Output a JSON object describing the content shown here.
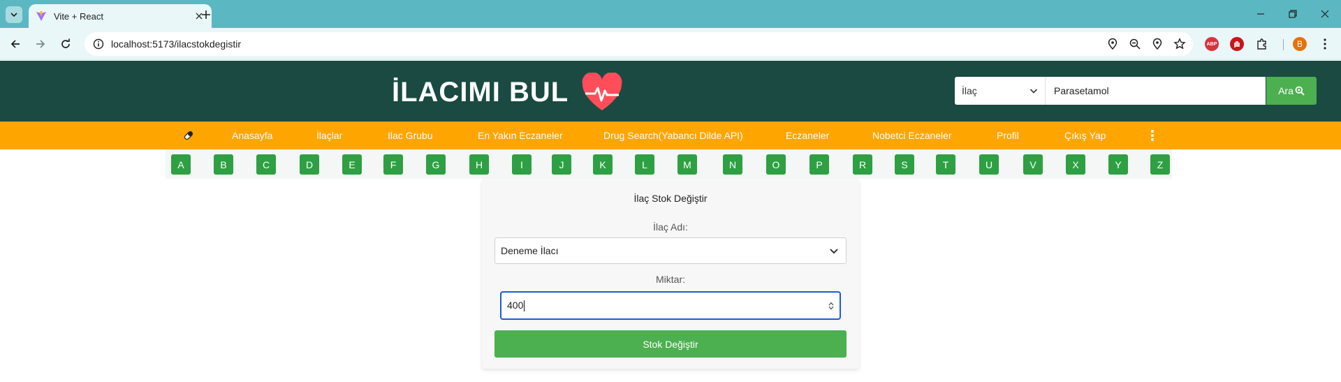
{
  "browser": {
    "tab_title": "Vite + React",
    "url": "localhost:5173/ilacstokdegistir",
    "profile_initial": "B",
    "abp_label": "ABP"
  },
  "header": {
    "brand_title": "İLACIMI BUL",
    "search": {
      "category_value": "İlaç",
      "query_value": "Parasetamol",
      "button_label": "Ara"
    }
  },
  "navbar": {
    "items": [
      {
        "label": "Anasayfa"
      },
      {
        "label": "İlaçlar"
      },
      {
        "label": "Ilac Grubu"
      },
      {
        "label": "En Yakın Eczaneler"
      },
      {
        "label": "Drug Search(Yabancı Dilde API)"
      },
      {
        "label": "Eczaneler"
      },
      {
        "label": "Nobetci Eczaneler"
      },
      {
        "label": "Profil"
      },
      {
        "label": "Çıkış Yap"
      }
    ],
    "more_glyph": "⋮"
  },
  "letters": [
    "A",
    "B",
    "C",
    "D",
    "E",
    "F",
    "G",
    "H",
    "I",
    "J",
    "K",
    "L",
    "M",
    "N",
    "O",
    "P",
    "R",
    "S",
    "T",
    "U",
    "V",
    "X",
    "Y",
    "Z"
  ],
  "form": {
    "title": "İlaç Stok Değiştir",
    "drug_label": "İlaç Adı:",
    "drug_value": "Deneme İlacı",
    "amount_label": "Miktar:",
    "amount_value": "400",
    "submit_label": "Stok Değiştir"
  },
  "colors": {
    "header_bg": "#1a4a42",
    "navbar_bg": "#ffa500",
    "accent_green": "#4caf50",
    "letter_green": "#2ea043",
    "heart": "#ff4d5a",
    "tabstrip": "#5bb8c2"
  }
}
